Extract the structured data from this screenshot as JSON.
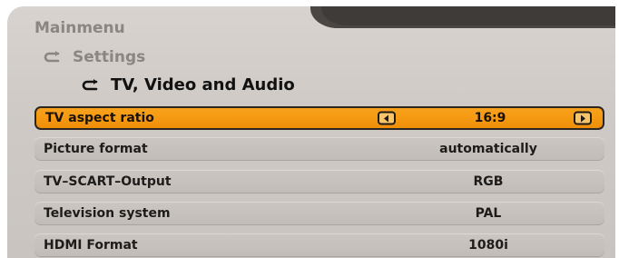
{
  "breadcrumb": {
    "main": "Mainmenu",
    "settings": "Settings",
    "current": "TV, Video and Audio"
  },
  "rows": [
    {
      "label": "TV aspect ratio",
      "value": "16:9",
      "selected": true
    },
    {
      "label": "Picture format",
      "value": "automatically",
      "selected": false
    },
    {
      "label": "TV–SCART–Output",
      "value": "RGB",
      "selected": false
    },
    {
      "label": "Television system",
      "value": "PAL",
      "selected": false
    },
    {
      "label": "HDMI Format",
      "value": "1080i",
      "selected": false
    }
  ],
  "icons": {
    "breadcrumb_arrow": "return-arrow-icon",
    "prev": "left-arrow-icon",
    "next": "right-arrow-icon"
  },
  "colors": {
    "highlight": "#f59a12",
    "panel": "#cfcac6",
    "tab_dark": "#3f3b39"
  }
}
